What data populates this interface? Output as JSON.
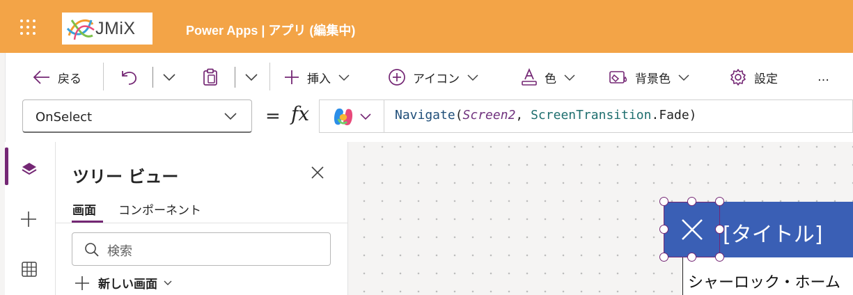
{
  "header": {
    "logo_text": "JMiX",
    "app_title": "Power Apps  |  アプリ (編集中)",
    "background_color": "#f3a447"
  },
  "toolbar": {
    "back_label": "戻る",
    "insert_label": "挿入",
    "icon_label": "アイコン",
    "color_label": "色",
    "background_color_label": "背景色",
    "settings_label": "設定",
    "more_label": "…"
  },
  "formula_bar": {
    "property": "OnSelect",
    "equals": "=",
    "fx": "fx",
    "formula": {
      "fn": "Navigate",
      "open": "(",
      "arg1": "Screen2",
      "comma": ", ",
      "enum": "ScreenTransition",
      "rest": ".Fade)"
    }
  },
  "tree_view": {
    "title": "ツリー ビュー",
    "tabs": [
      {
        "label": "画面",
        "active": true
      },
      {
        "label": "コンポーネント",
        "active": false
      }
    ],
    "search_placeholder": "検索",
    "new_screen_label": "新しい画面"
  },
  "canvas": {
    "title_label": "[タイトル]",
    "body_text": "シャーロック・ホーム",
    "header_color": "#3a5fb5",
    "selection_color": "#742774"
  }
}
